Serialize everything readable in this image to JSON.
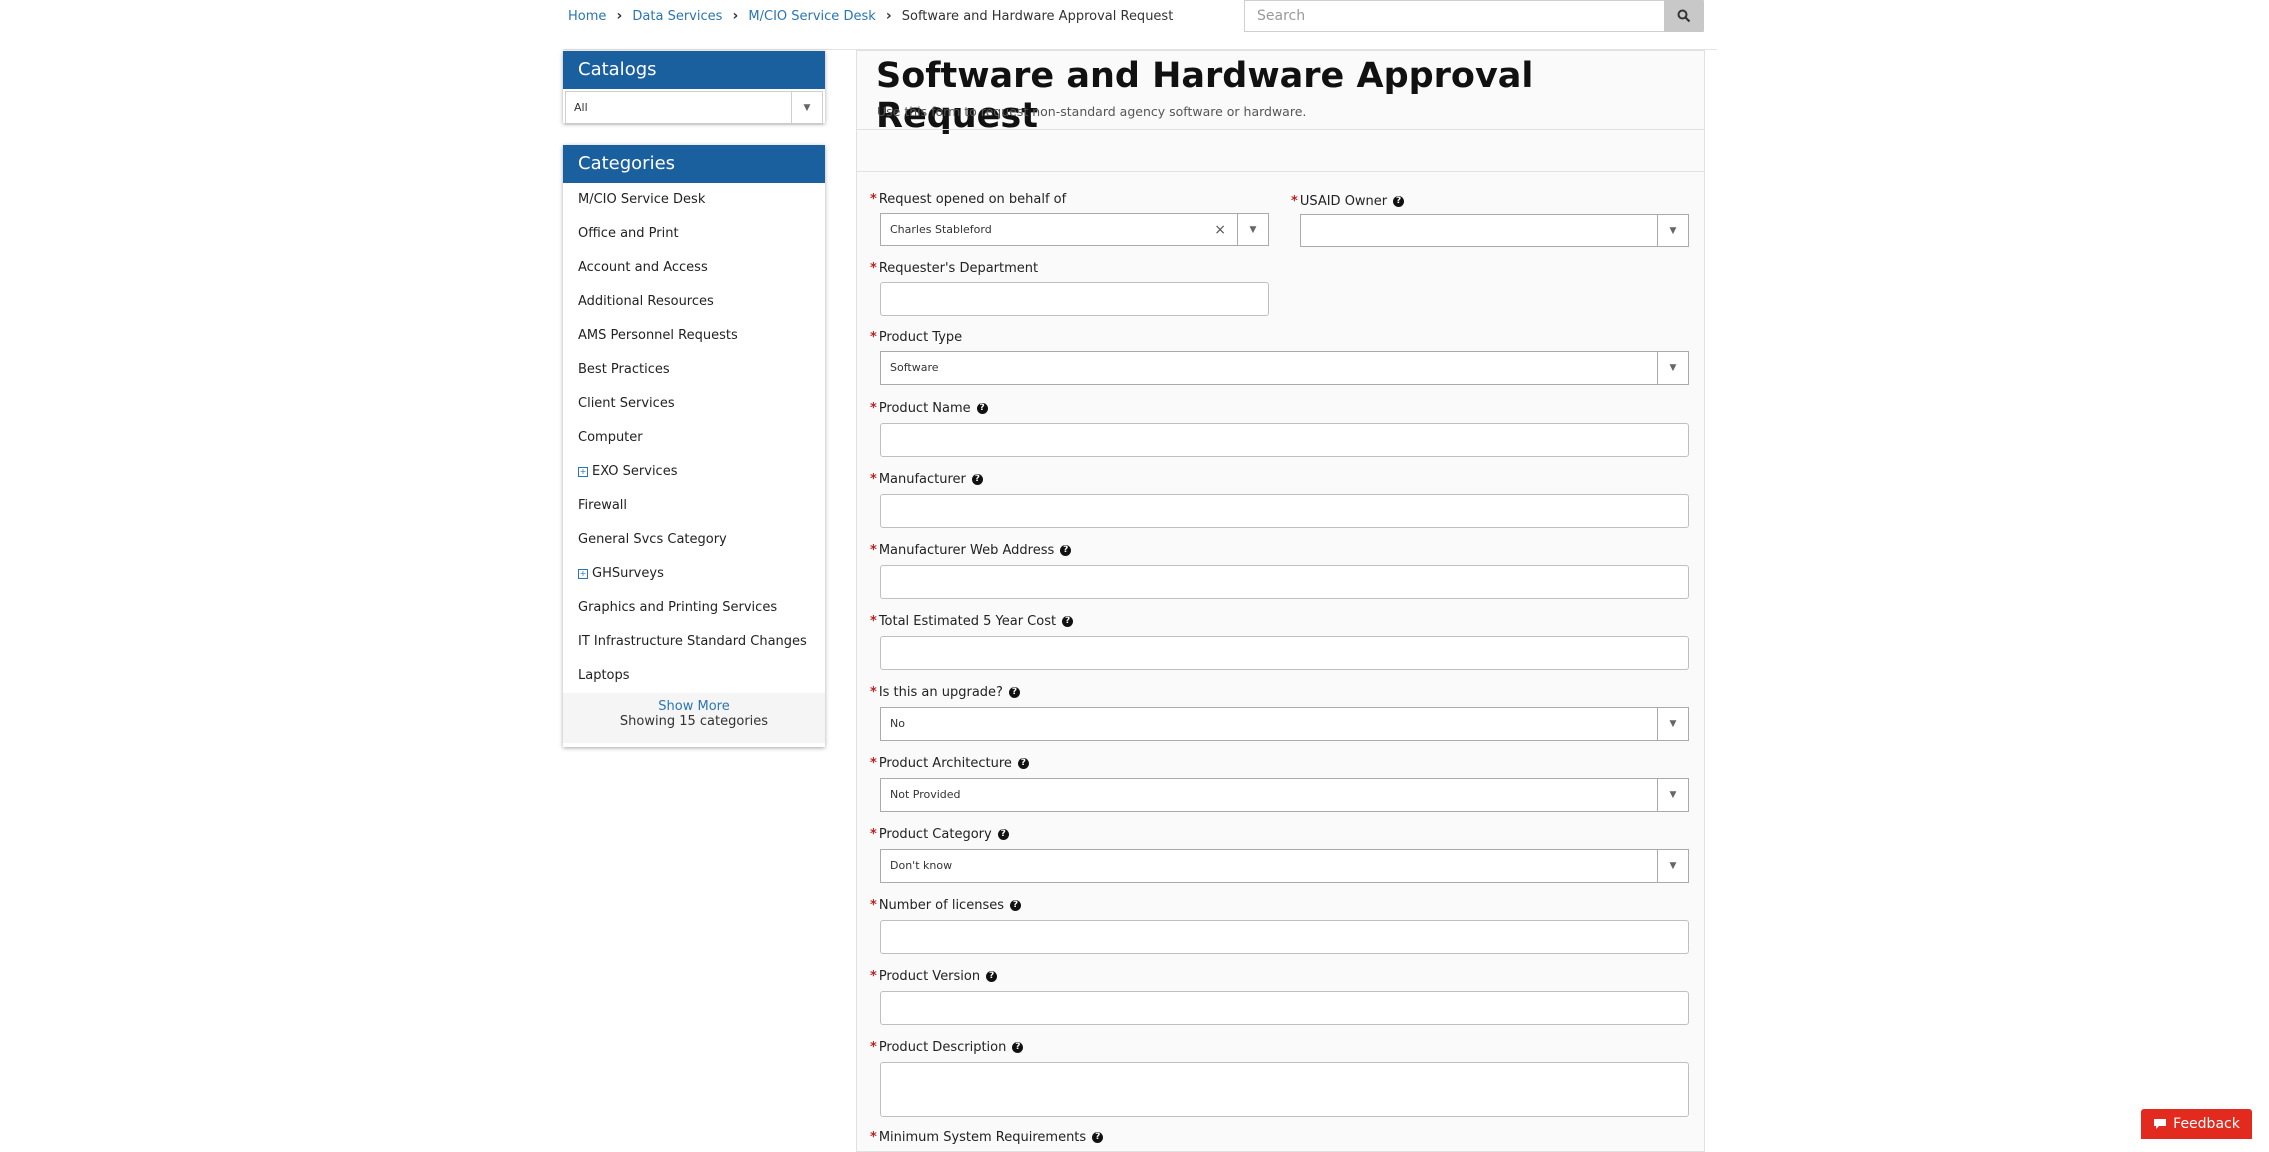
{
  "breadcrumb": {
    "items": [
      "Home",
      "Data Services",
      "M/CIO Service Desk"
    ],
    "current": "Software and Hardware Approval Request"
  },
  "search": {
    "placeholder": "Search"
  },
  "catalogs": {
    "title": "Catalogs",
    "selected": "All"
  },
  "categories": {
    "title": "Categories",
    "items": [
      {
        "label": "M/CIO Service Desk",
        "expandable": false
      },
      {
        "label": "Office and Print",
        "expandable": false
      },
      {
        "label": "Account and Access",
        "expandable": false
      },
      {
        "label": "Additional Resources",
        "expandable": false
      },
      {
        "label": "AMS Personnel Requests",
        "expandable": false
      },
      {
        "label": "Best Practices",
        "expandable": false
      },
      {
        "label": "Client Services",
        "expandable": false
      },
      {
        "label": "Computer",
        "expandable": false
      },
      {
        "label": "EXO Services",
        "expandable": true
      },
      {
        "label": "Firewall",
        "expandable": false
      },
      {
        "label": "General Svcs Category",
        "expandable": false
      },
      {
        "label": "GHSurveys",
        "expandable": true
      },
      {
        "label": "Graphics and Printing Services",
        "expandable": false
      },
      {
        "label": "IT Infrastructure Standard Changes",
        "expandable": false
      },
      {
        "label": "Laptops",
        "expandable": false
      }
    ],
    "show_more": "Show More",
    "showing": "Showing 15 categories"
  },
  "form": {
    "title": "Software and Hardware Approval Request",
    "subtitle": "Use this form to request non-standard agency software or hardware.",
    "fields": {
      "on_behalf": {
        "label": "Request opened on behalf of",
        "value": "Charles Stableford"
      },
      "usaid_owner": {
        "label": "USAID Owner",
        "value": ""
      },
      "department": {
        "label": "Requester's Department",
        "value": ""
      },
      "product_type": {
        "label": "Product Type",
        "value": "Software"
      },
      "product_name": {
        "label": "Product Name",
        "value": ""
      },
      "manufacturer": {
        "label": "Manufacturer",
        "value": ""
      },
      "web_address": {
        "label": "Manufacturer Web Address",
        "value": ""
      },
      "cost": {
        "label": "Total Estimated 5 Year Cost",
        "value": ""
      },
      "upgrade": {
        "label": "Is this an upgrade?",
        "value": "No"
      },
      "architecture": {
        "label": "Product Architecture",
        "value": "Not Provided"
      },
      "category": {
        "label": "Product Category",
        "value": "Don't know"
      },
      "licenses": {
        "label": "Number of licenses",
        "value": ""
      },
      "version": {
        "label": "Product Version",
        "value": ""
      },
      "description": {
        "label": "Product Description",
        "value": ""
      },
      "min_requirements": {
        "label": "Minimum System Requirements",
        "value": ""
      }
    }
  },
  "feedback": {
    "label": "Feedback"
  },
  "colors": {
    "brand": "#1a5f9e",
    "link": "#2a75b3",
    "required": "#b22222",
    "feedback": "#e22a1f"
  }
}
